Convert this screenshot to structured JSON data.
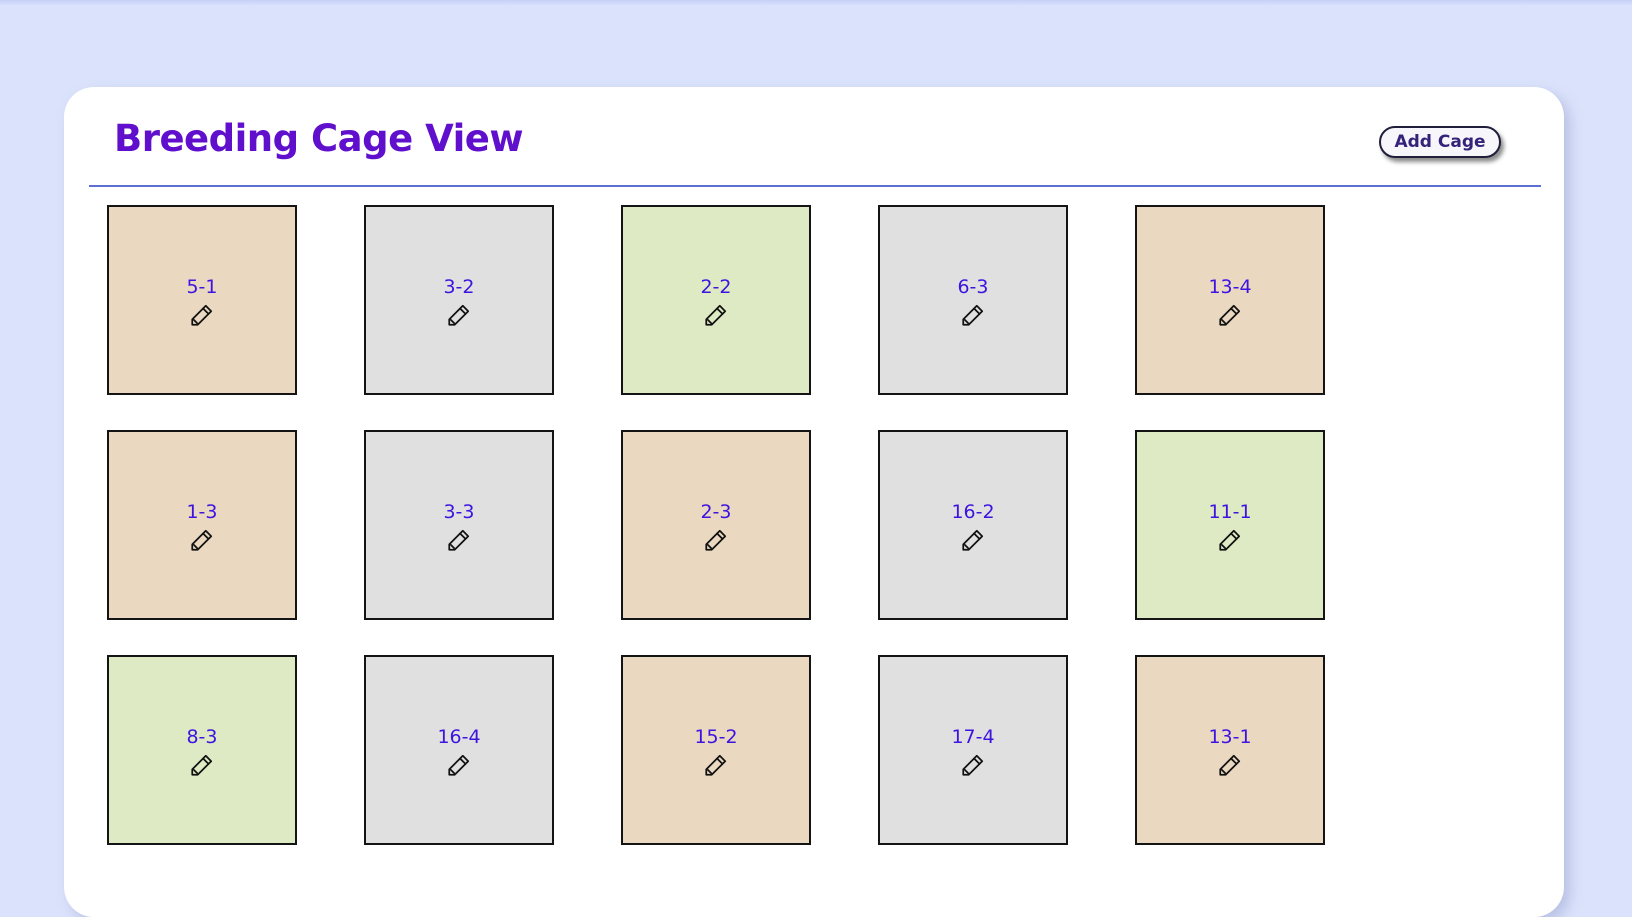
{
  "page": {
    "title": "Breeding Cage View",
    "add_button_label": "Add Cage"
  },
  "colors": {
    "title": "#6010cc",
    "cage_label": "#3d14e0",
    "divider": "#5d6fd3",
    "tan": "#ead8c1",
    "grey": "#e0e0e0",
    "green": "#deeac3"
  },
  "cages": [
    {
      "label": "5-1",
      "color": "tan",
      "icon": "pencil-edit-icon"
    },
    {
      "label": "3-2",
      "color": "grey",
      "icon": "pencil-edit-icon"
    },
    {
      "label": "2-2",
      "color": "green",
      "icon": "pencil-edit-icon"
    },
    {
      "label": "6-3",
      "color": "grey",
      "icon": "pencil-edit-icon"
    },
    {
      "label": "13-4",
      "color": "tan",
      "icon": "pencil-edit-icon"
    },
    {
      "label": "1-3",
      "color": "tan",
      "icon": "pencil-edit-icon"
    },
    {
      "label": "3-3",
      "color": "grey",
      "icon": "pencil-edit-icon"
    },
    {
      "label": "2-3",
      "color": "tan",
      "icon": "pencil-edit-icon"
    },
    {
      "label": "16-2",
      "color": "grey",
      "icon": "pencil-edit-icon"
    },
    {
      "label": "11-1",
      "color": "green",
      "icon": "pencil-edit-icon"
    },
    {
      "label": "8-3",
      "color": "green",
      "icon": "pencil-edit-icon"
    },
    {
      "label": "16-4",
      "color": "grey",
      "icon": "pencil-edit-icon"
    },
    {
      "label": "15-2",
      "color": "tan",
      "icon": "pencil-edit-icon"
    },
    {
      "label": "17-4",
      "color": "grey",
      "icon": "pencil-edit-icon"
    },
    {
      "label": "13-1",
      "color": "tan",
      "icon": "pencil-edit-icon"
    }
  ]
}
